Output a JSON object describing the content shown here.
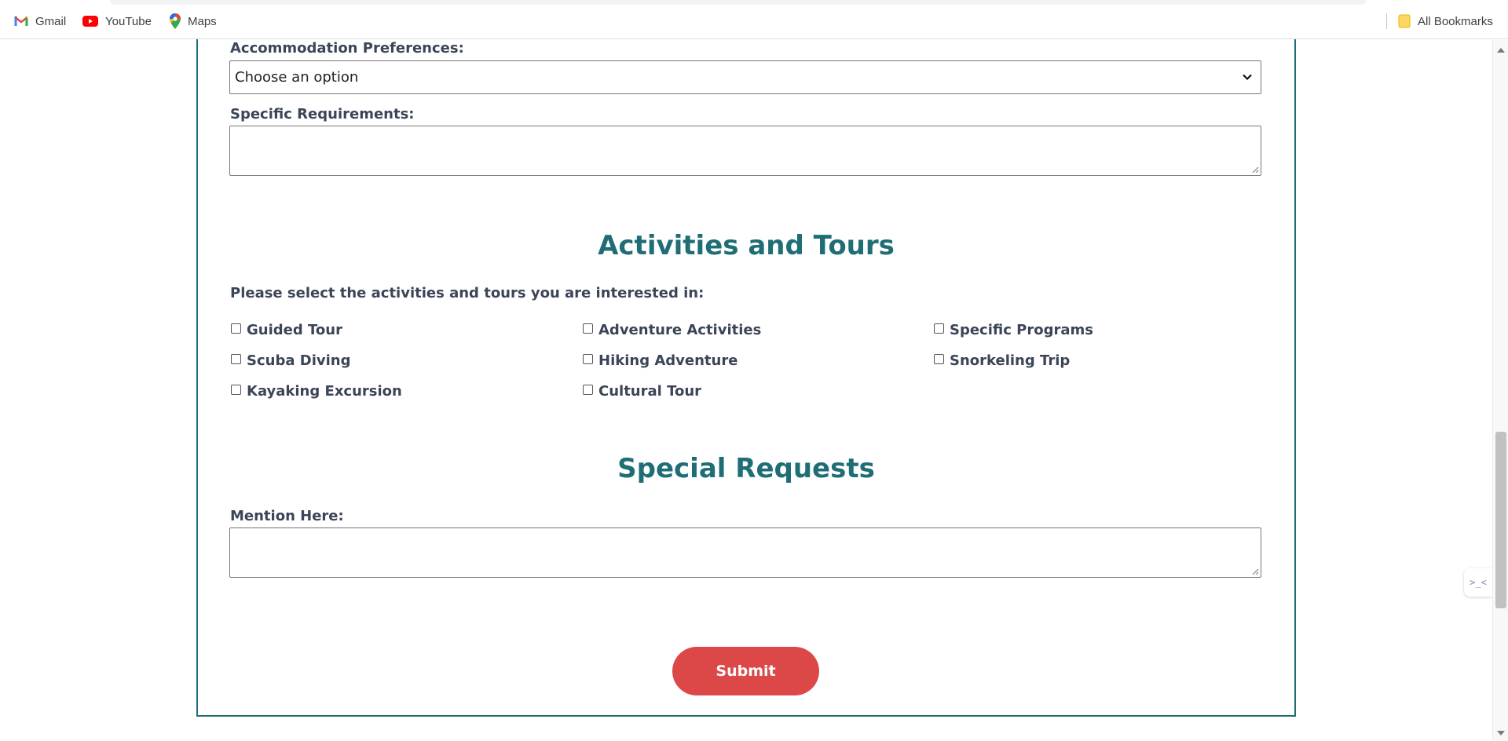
{
  "bookmarks": {
    "gmail": "Gmail",
    "youtube": "YouTube",
    "maps": "Maps",
    "all": "All Bookmarks"
  },
  "form": {
    "accommodation_label": "Accommodation Preferences:",
    "accommodation_selected": "Choose an option",
    "requirements_label": "Specific Requirements:",
    "activities_heading": "Activities and Tours",
    "activities_prompt": "Please select the activities and tours you are interested in:",
    "activities": [
      {
        "label": "Guided Tour",
        "checked": false
      },
      {
        "label": "Adventure Activities",
        "checked": false
      },
      {
        "label": "Specific Programs",
        "checked": false
      },
      {
        "label": "Scuba Diving",
        "checked": false
      },
      {
        "label": "Hiking Adventure",
        "checked": false
      },
      {
        "label": "Snorkeling Trip",
        "checked": false
      },
      {
        "label": "Kayaking Excursion",
        "checked": false
      },
      {
        "label": "Cultural Tour",
        "checked": false
      }
    ],
    "special_heading": "Special Requests",
    "mention_label": "Mention Here:",
    "submit_label": "Submit"
  },
  "colors": {
    "accent": "#1f6e76",
    "submit": "#dc4848",
    "label": "#3b4557"
  },
  "extension_widget": {
    "icon": "terminal-icon",
    "glyph": ">_<"
  }
}
